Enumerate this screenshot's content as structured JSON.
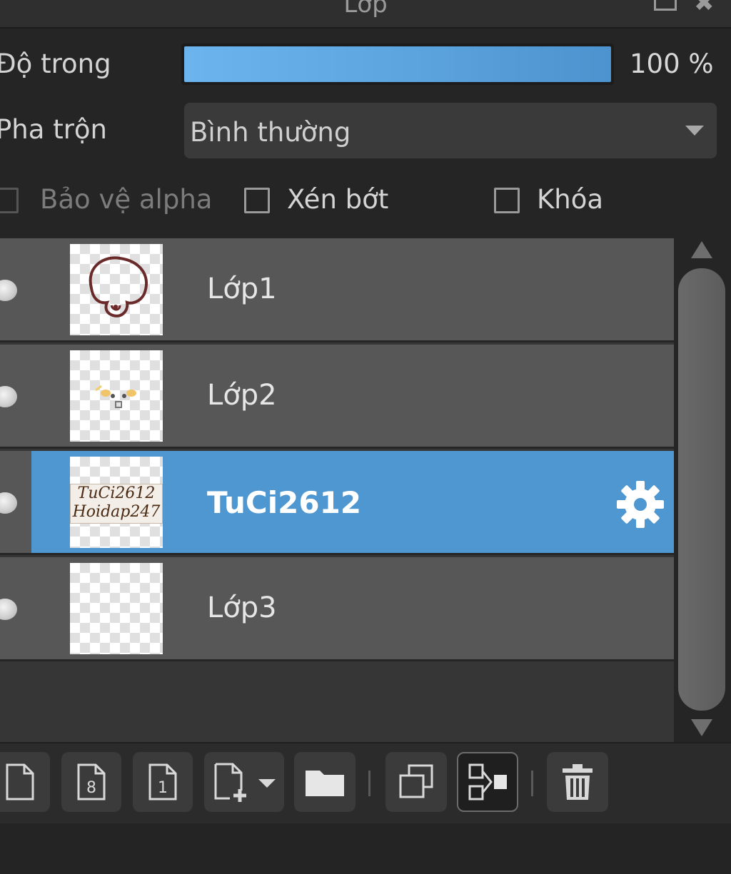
{
  "panel": {
    "title": "Lớp"
  },
  "properties": {
    "opacity_label": "Độ trong",
    "opacity_value": "100 %",
    "opacity_fraction": 1.0,
    "blend_label": "Pha trộn",
    "blend_value": "Bình thường"
  },
  "options": {
    "protect_alpha": {
      "label": "Bảo vệ alpha",
      "checked": false,
      "enabled": false
    },
    "clipping": {
      "label": "Xén bớt",
      "checked": false,
      "enabled": true
    },
    "lock": {
      "label": "Khóa",
      "checked": false,
      "enabled": true
    }
  },
  "layers": [
    {
      "name": "Lớp1",
      "visible": true,
      "selected": false,
      "thumbnail": "mascot-outline"
    },
    {
      "name": "Lớp2",
      "visible": true,
      "selected": false,
      "thumbnail": "mascot-face"
    },
    {
      "name": "TuCi2612",
      "visible": true,
      "selected": true,
      "thumbnail": "text-layer",
      "thumbnail_text": [
        "TuCi2612",
        "Hoidap247"
      ]
    },
    {
      "name": "Lớp3",
      "visible": true,
      "selected": false,
      "thumbnail": "empty"
    }
  ],
  "toolbar": {
    "buttons": [
      {
        "name": "new-layer",
        "icon": "page-icon"
      },
      {
        "name": "new-8bit-layer",
        "icon": "page-8-icon"
      },
      {
        "name": "new-1bit-layer",
        "icon": "page-1-icon"
      },
      {
        "name": "add-layer-menu",
        "icon": "page-plus-dropdown-icon"
      },
      {
        "name": "new-folder",
        "icon": "folder-icon"
      },
      {
        "name": "duplicate-layer",
        "icon": "duplicate-icon"
      },
      {
        "name": "merge-down",
        "icon": "merge-icon"
      },
      {
        "name": "delete-layer",
        "icon": "trash-icon"
      }
    ]
  },
  "colors": {
    "selection": "#4f97d1",
    "row": "#575757",
    "panel_bg": "#252525",
    "opacity_fill": "#5aa2dc"
  }
}
